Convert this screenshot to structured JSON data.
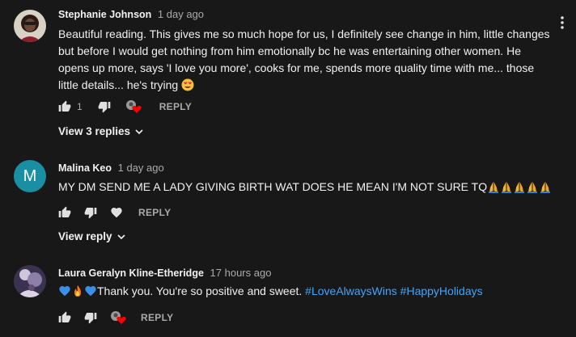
{
  "comments": [
    {
      "author": "Stephanie Johnson",
      "time": "1 day ago",
      "text": "Beautiful reading. This gives me so much hope for us, I definitely see change in him, little changes but before I would get nothing from him emotionally bc he was entertaining other women. He opens up more, says 'I love you more', cooks for me, spends more quality time with me... those little details... he's trying",
      "likes": "1",
      "reply_label": "REPLY",
      "replies_label": "View 3 replies"
    },
    {
      "author": "Malina Keo",
      "time": "1 day ago",
      "avatar_letter": "M",
      "avatar_color": "#1a8fa3",
      "text": "MY DM SEND ME A LADY GIVING BIRTH WAT DOES HE MEAN I'M NOT SURE TQ",
      "reply_label": "REPLY",
      "replies_label": "View reply"
    },
    {
      "author": "Laura Geralyn Kline-Etheridge",
      "time": "17 hours ago",
      "text": "Thank you. You're so positive and sweet.",
      "hashtags": [
        "#LoveAlwaysWins",
        "#HappyHolidays"
      ],
      "reply_label": "REPLY"
    }
  ],
  "colors": {
    "background": "#181818",
    "link": "#3ea6ff",
    "muted": "#aaaaaa",
    "heart": "#ff0000"
  },
  "icons": [
    "thumb-up-icon",
    "thumb-down-icon",
    "heart-icon",
    "creator-heart-icon",
    "chevron-down-icon",
    "more-vert-icon",
    "folded-hands-emoji",
    "heart-eyes-emoji",
    "blue-heart-emoji",
    "fire-emoji"
  ]
}
